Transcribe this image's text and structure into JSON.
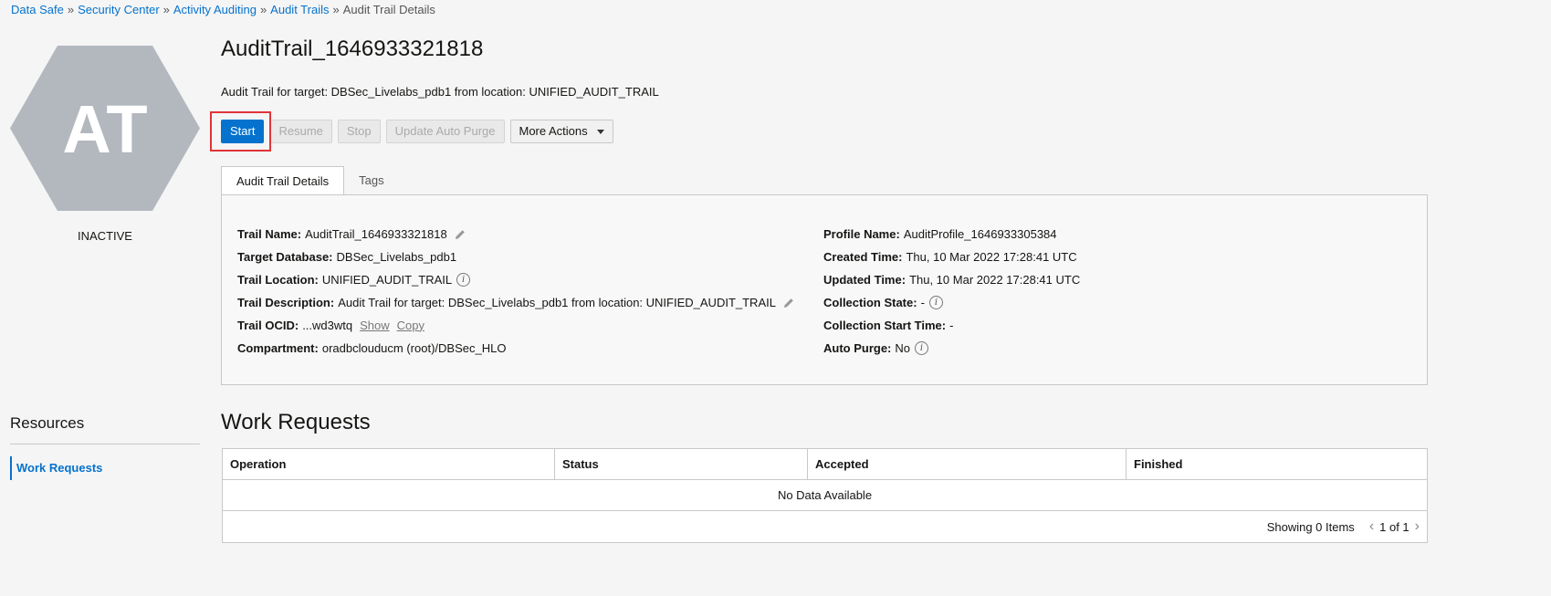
{
  "breadcrumb": {
    "items": [
      "Data Safe",
      "Security Center",
      "Activity Auditing",
      "Audit Trails"
    ],
    "current": "Audit Trail Details",
    "separator": "»"
  },
  "avatar": {
    "initials": "AT",
    "status": "INACTIVE",
    "color": "#b3b8bf"
  },
  "header": {
    "title": "AuditTrail_1646933321818",
    "subtitle": "Audit Trail for target: DBSec_Livelabs_pdb1 from location: UNIFIED_AUDIT_TRAIL"
  },
  "actions": {
    "start": "Start",
    "resume": "Resume",
    "stop": "Stop",
    "update_auto_purge": "Update Auto Purge",
    "more_actions": "More Actions"
  },
  "tabs": {
    "details": "Audit Trail Details",
    "tags": "Tags"
  },
  "details": {
    "trail_name_label": "Trail Name:",
    "trail_name": "AuditTrail_1646933321818",
    "target_db_label": "Target Database:",
    "target_db": "DBSec_Livelabs_pdb1",
    "trail_location_label": "Trail Location:",
    "trail_location": "UNIFIED_AUDIT_TRAIL",
    "trail_desc_label": "Trail Description:",
    "trail_desc": "Audit Trail for target: DBSec_Livelabs_pdb1 from location: UNIFIED_AUDIT_TRAIL",
    "trail_ocid_label": "Trail OCID:",
    "trail_ocid": "...wd3wtq",
    "show": "Show",
    "copy": "Copy",
    "compartment_label": "Compartment:",
    "compartment": "oradbclouducm (root)/DBSec_HLO",
    "profile_name_label": "Profile Name:",
    "profile_name": "AuditProfile_1646933305384",
    "created_label": "Created Time:",
    "created": "Thu, 10 Mar 2022 17:28:41 UTC",
    "updated_label": "Updated Time:",
    "updated": "Thu, 10 Mar 2022 17:28:41 UTC",
    "collection_state_label": "Collection State:",
    "collection_state": "-",
    "collection_start_label": "Collection Start Time:",
    "collection_start": "-",
    "auto_purge_label": "Auto Purge:",
    "auto_purge": "No"
  },
  "resources": {
    "title": "Resources",
    "items": [
      "Work Requests"
    ]
  },
  "work_requests": {
    "title": "Work Requests",
    "columns": [
      "Operation",
      "Status",
      "Accepted",
      "Finished"
    ],
    "empty": "No Data Available",
    "showing": "Showing 0 Items",
    "page": "1 of 1"
  }
}
